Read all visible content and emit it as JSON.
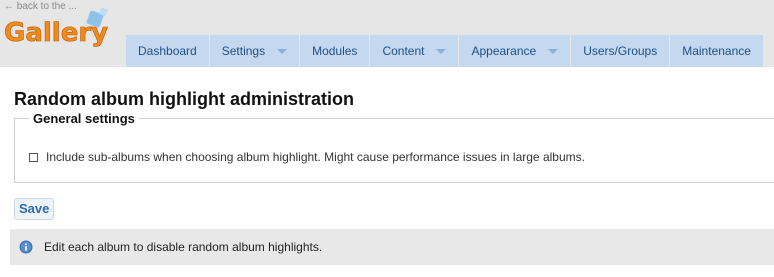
{
  "header": {
    "back_link": "← back to the ...",
    "logo_text": "Gallery"
  },
  "nav": {
    "items": [
      {
        "label": "Dashboard",
        "has_dropdown": false
      },
      {
        "label": "Settings",
        "has_dropdown": true
      },
      {
        "label": "Modules",
        "has_dropdown": false
      },
      {
        "label": "Content",
        "has_dropdown": true
      },
      {
        "label": "Appearance",
        "has_dropdown": true
      },
      {
        "label": "Users/Groups",
        "has_dropdown": false
      },
      {
        "label": "Maintenance",
        "has_dropdown": false
      }
    ]
  },
  "main": {
    "title": "Random album highlight administration",
    "general_settings": {
      "legend": "General settings",
      "include_subalbums": {
        "label": "Include sub-albums when choosing album highlight. Might cause performance issues in large albums.",
        "checked": false
      }
    },
    "save_label": "Save",
    "info_message": "Edit each album to disable random album highlights."
  },
  "colors": {
    "header_bg": "#e6e6e6",
    "nav_tab_bg": "#c4d8ef",
    "nav_text": "#1f4f86",
    "logo_orange": "#f08a1c",
    "info_bg": "#e8e8e8",
    "save_text": "#2a6db0"
  },
  "icons": {
    "info": "info-icon",
    "logo": "gallery-logo"
  }
}
